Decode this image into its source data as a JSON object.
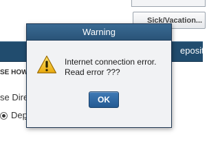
{
  "background": {
    "button_label": "Sick/Vacation...",
    "navbar_text": "eposit",
    "section_label": "SE HOW",
    "row_label": "se Dire",
    "radio_label_prefix": "De",
    "radio_label_underlined": "p",
    "radio_checked": true
  },
  "dialog": {
    "title": "Warning",
    "message_line1": "Internet connection error.",
    "message_line2": "Read error ???",
    "ok_label": "OK",
    "icon": "warning-triangle-icon"
  },
  "colors": {
    "navbar": "#214c6e",
    "dialog_title_bar": "#2f5c82",
    "ok_button": "#2f6aa5",
    "warning_yellow": "#f2c21b"
  }
}
